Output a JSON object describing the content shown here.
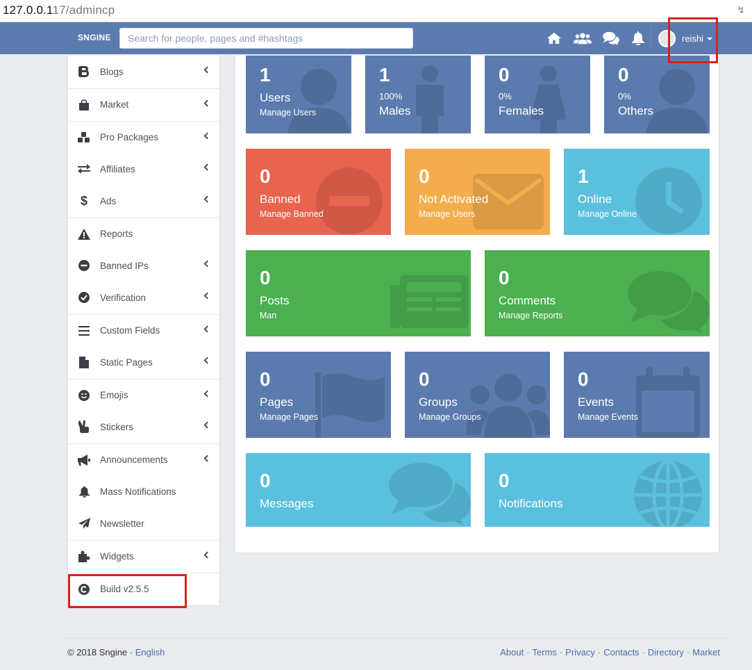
{
  "browser": {
    "url_host": "127.0.0.1",
    "url_port_path": "17/admincp",
    "bolt_icon": "lightning-icon"
  },
  "topnav": {
    "brand": "SNGINE",
    "search_placeholder": "Search for people, pages and #hashtags",
    "username": "reishi",
    "bg_color": "#5b7bae"
  },
  "sidebar": {
    "items": [
      {
        "label": "Blogs",
        "icon": "blog-icon"
      },
      {
        "label": "Market",
        "icon": "shopping-bag-icon"
      },
      {
        "label": "Pro Packages",
        "icon": "cubes-icon"
      },
      {
        "label": "Affiliates",
        "icon": "exchange-icon"
      },
      {
        "label": "Ads",
        "icon": "dollar-icon"
      },
      {
        "label": "Reports",
        "icon": "warning-icon"
      },
      {
        "label": "Banned IPs",
        "icon": "minus-circle-icon"
      },
      {
        "label": "Verification",
        "icon": "check-circle-icon"
      },
      {
        "label": "Custom Fields",
        "icon": "bars-icon"
      },
      {
        "label": "Static Pages",
        "icon": "file-icon"
      },
      {
        "label": "Emojis",
        "icon": "smile-icon"
      },
      {
        "label": "Stickers",
        "icon": "hand-peace-icon"
      },
      {
        "label": "Announcements",
        "icon": "bullhorn-icon"
      },
      {
        "label": "Mass Notifications",
        "icon": "bell-icon"
      },
      {
        "label": "Newsletter",
        "icon": "paper-plane-icon"
      },
      {
        "label": "Widgets",
        "icon": "puzzle-icon"
      },
      {
        "label": "Build v2.5.5",
        "icon": "copyright-icon"
      }
    ]
  },
  "stats": {
    "users": {
      "num": "1",
      "title": "Users",
      "sub": "Manage Users"
    },
    "males": {
      "num": "1",
      "pct": "100%",
      "title": "Males"
    },
    "females": {
      "num": "0",
      "pct": "0%",
      "title": "Females"
    },
    "others": {
      "num": "0",
      "pct": "0%",
      "title": "Others"
    },
    "banned": {
      "num": "0",
      "title": "Banned",
      "sub": "Manage Banned"
    },
    "not_activated": {
      "num": "0",
      "title": "Not Activated",
      "sub": "Manage Users"
    },
    "online": {
      "num": "1",
      "title": "Online",
      "sub": "Manage Online"
    },
    "posts": {
      "num": "0",
      "title": "Posts",
      "sub": "Man"
    },
    "comments": {
      "num": "0",
      "title": "Comments",
      "sub": "Manage Reports"
    },
    "pages": {
      "num": "0",
      "title": "Pages",
      "sub": "Manage Pages"
    },
    "groups": {
      "num": "0",
      "title": "Groups",
      "sub": "Manage Groups"
    },
    "events": {
      "num": "0",
      "title": "Events",
      "sub": "Manage Events"
    },
    "messages": {
      "num": "0",
      "title": "Messages"
    },
    "notifications": {
      "num": "0",
      "title": "Notifications"
    }
  },
  "colors": {
    "blue": "#5b7bae",
    "red": "#e8644f",
    "orange": "#f3ad4c",
    "cyan": "#5bc0de",
    "green": "#4caf50",
    "annotation": "#d9201e"
  },
  "footer": {
    "copyright": "© 2018 Sngine · ",
    "language": "English",
    "links": [
      "About",
      "Terms",
      "Privacy",
      "Contacts",
      "Directory",
      "Market"
    ]
  }
}
